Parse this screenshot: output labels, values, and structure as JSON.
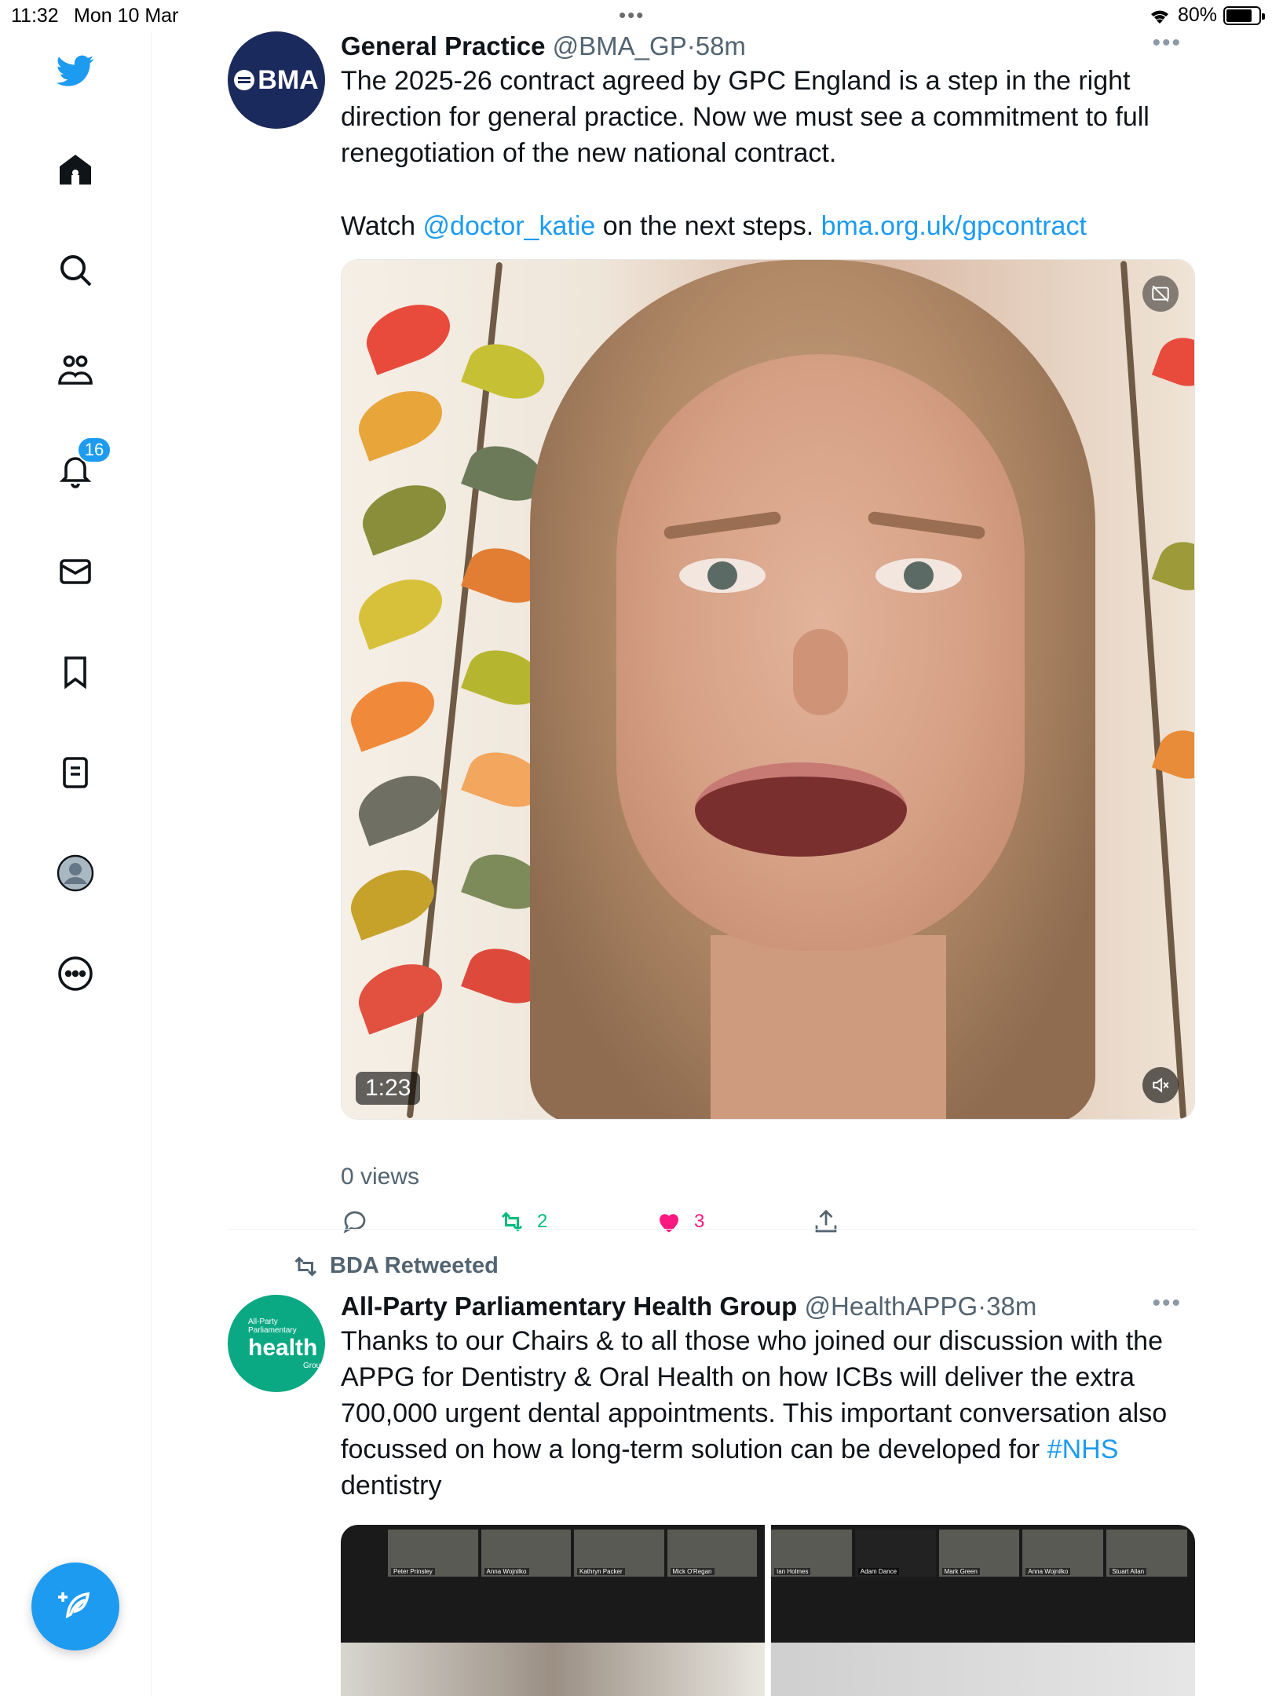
{
  "status_bar": {
    "time": "11:32",
    "date": "Mon 10 Mar",
    "battery_pct_label": "80%",
    "battery_level": 0.8
  },
  "sidebar": {
    "items": [
      {
        "name": "home",
        "icon": "home-icon"
      },
      {
        "name": "search",
        "icon": "search-icon"
      },
      {
        "name": "communities",
        "icon": "communities-icon"
      },
      {
        "name": "notifications",
        "icon": "bell-icon",
        "badge": "16"
      },
      {
        "name": "messages",
        "icon": "mail-icon"
      },
      {
        "name": "bookmarks",
        "icon": "bookmark-icon"
      },
      {
        "name": "lists",
        "icon": "list-icon"
      },
      {
        "name": "profile",
        "icon": "profile-icon"
      },
      {
        "name": "more",
        "icon": "more-circle-icon"
      }
    ],
    "notification_badge": "16",
    "compose_icon": "compose-feather-icon"
  },
  "tweets": [
    {
      "author_name": "General Practice",
      "handle": "@BMA_GP",
      "sep": "·",
      "time": "58m",
      "avatar_text": "BMA",
      "text_p1": "The 2025-26 contract agreed by GPC England is a step in the right direction for general practice. Now we must see a commitment to full renegotiation of the new national contract.",
      "text_p2_prefix": "Watch ",
      "mention": "@doctor_katie",
      "text_p2_mid": " on the next steps. ",
      "link": "bma.org.uk/gpcontract",
      "video_duration": "1:23",
      "views": "0 views",
      "retweets": "2",
      "likes": "3",
      "accent_like": "#f91880",
      "accent_retweet": "#00ba7c"
    },
    {
      "retweeted_by": "BDA Retweeted",
      "author_name": "All-Party Parliamentary Health Group",
      "handle": "@HealthAPPG",
      "sep": "·",
      "time": "38m",
      "avatar_small1": "All-Party",
      "avatar_small2": "Parliamentary",
      "avatar_big": "health",
      "avatar_small3": "Group",
      "text_main": "Thanks to our Chairs & to all those who joined our discussion with the APPG for Dentistry & Oral Health on how ICBs will deliver the extra 700,000 urgent dental appointments. This important conversation also focussed on how a long-term solution can be developed for ",
      "hashtag": "#NHS",
      "text_end": " dentistry",
      "vc_left_labels": [
        "Peter Prinsley",
        "Anna Wojnilko",
        "Kathryn Packer",
        "Mick O'Regan"
      ],
      "vc_right_labels": [
        "Ian Holmes",
        "Adam Dance",
        "Mark Green",
        "Anna Wojnilko",
        "Stuart Allan"
      ]
    }
  ],
  "colors": {
    "brand": "#1d9bf0",
    "bma_navy": "#1b2a5c",
    "appg_teal": "#0aa883"
  }
}
